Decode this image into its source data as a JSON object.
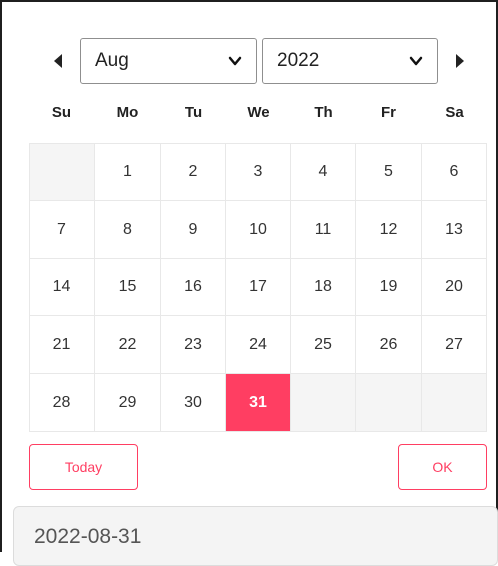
{
  "header": {
    "prev_icon": "triangle-left-icon",
    "next_icon": "triangle-right-icon",
    "month": "Aug",
    "year": "2022"
  },
  "weekdays": [
    "Su",
    "Mo",
    "Tu",
    "We",
    "Th",
    "Fr",
    "Sa"
  ],
  "weeks": [
    [
      "",
      "1",
      "2",
      "3",
      "4",
      "5",
      "6"
    ],
    [
      "7",
      "8",
      "9",
      "10",
      "11",
      "12",
      "13"
    ],
    [
      "14",
      "15",
      "16",
      "17",
      "18",
      "19",
      "20"
    ],
    [
      "21",
      "22",
      "23",
      "24",
      "25",
      "26",
      "27"
    ],
    [
      "28",
      "29",
      "30",
      "31",
      "",
      "",
      ""
    ]
  ],
  "selected_day": "31",
  "buttons": {
    "today": "Today",
    "ok": "OK"
  },
  "date_field": {
    "value": "2022-08-31"
  },
  "colors": {
    "accent": "#ff3e62",
    "empty_cell": "#f5f5f5"
  }
}
